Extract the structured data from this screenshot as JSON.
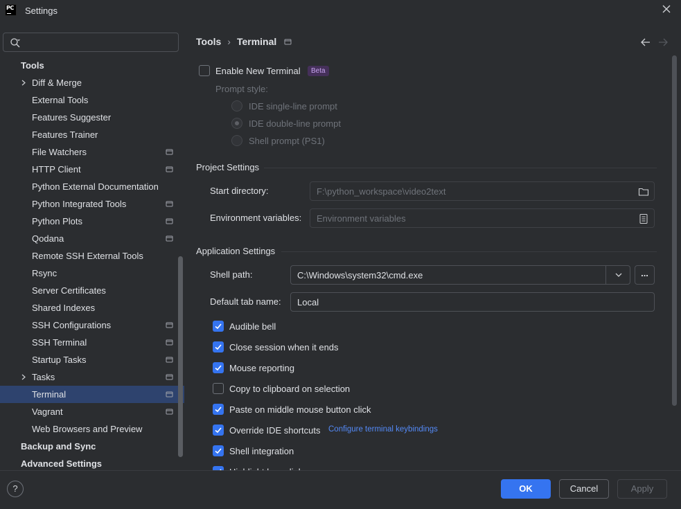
{
  "window": {
    "title": "Settings",
    "logo_text": "PC"
  },
  "search": {
    "placeholder": "",
    "value": ""
  },
  "sidebar": {
    "items": [
      {
        "label": "Tools",
        "level": 1,
        "chevron": false,
        "project": false,
        "selected": false
      },
      {
        "label": "Diff & Merge",
        "level": 2,
        "chevron": true,
        "project": false,
        "selected": false
      },
      {
        "label": "External Tools",
        "level": 2,
        "chevron": false,
        "project": false,
        "selected": false
      },
      {
        "label": "Features Suggester",
        "level": 2,
        "chevron": false,
        "project": false,
        "selected": false
      },
      {
        "label": "Features Trainer",
        "level": 2,
        "chevron": false,
        "project": false,
        "selected": false
      },
      {
        "label": "File Watchers",
        "level": 2,
        "chevron": false,
        "project": true,
        "selected": false
      },
      {
        "label": "HTTP Client",
        "level": 2,
        "chevron": false,
        "project": true,
        "selected": false
      },
      {
        "label": "Python External Documentation",
        "level": 2,
        "chevron": false,
        "project": false,
        "selected": false
      },
      {
        "label": "Python Integrated Tools",
        "level": 2,
        "chevron": false,
        "project": true,
        "selected": false
      },
      {
        "label": "Python Plots",
        "level": 2,
        "chevron": false,
        "project": true,
        "selected": false
      },
      {
        "label": "Qodana",
        "level": 2,
        "chevron": false,
        "project": true,
        "selected": false
      },
      {
        "label": "Remote SSH External Tools",
        "level": 2,
        "chevron": false,
        "project": false,
        "selected": false
      },
      {
        "label": "Rsync",
        "level": 2,
        "chevron": false,
        "project": false,
        "selected": false
      },
      {
        "label": "Server Certificates",
        "level": 2,
        "chevron": false,
        "project": false,
        "selected": false
      },
      {
        "label": "Shared Indexes",
        "level": 2,
        "chevron": false,
        "project": false,
        "selected": false
      },
      {
        "label": "SSH Configurations",
        "level": 2,
        "chevron": false,
        "project": true,
        "selected": false
      },
      {
        "label": "SSH Terminal",
        "level": 2,
        "chevron": false,
        "project": true,
        "selected": false
      },
      {
        "label": "Startup Tasks",
        "level": 2,
        "chevron": false,
        "project": true,
        "selected": false
      },
      {
        "label": "Tasks",
        "level": 2,
        "chevron": true,
        "project": true,
        "selected": false
      },
      {
        "label": "Terminal",
        "level": 2,
        "chevron": false,
        "project": true,
        "selected": true
      },
      {
        "label": "Vagrant",
        "level": 2,
        "chevron": false,
        "project": true,
        "selected": false
      },
      {
        "label": "Web Browsers and Preview",
        "level": 2,
        "chevron": false,
        "project": false,
        "selected": false
      },
      {
        "label": "Backup and Sync",
        "level": 1,
        "chevron": false,
        "project": false,
        "selected": false
      },
      {
        "label": "Advanced Settings",
        "level": 1,
        "chevron": false,
        "project": false,
        "selected": false
      }
    ]
  },
  "breadcrumb": {
    "parent": "Tools",
    "separator": "›",
    "current": "Terminal"
  },
  "new_terminal": {
    "label": "Enable New Terminal",
    "checked": false,
    "badge": "Beta",
    "prompt_style_label": "Prompt style:",
    "options": [
      "IDE single-line prompt",
      "IDE double-line prompt",
      "Shell prompt (PS1)"
    ],
    "selected_option": "IDE double-line prompt"
  },
  "project_settings": {
    "title": "Project Settings",
    "start_directory_label": "Start directory:",
    "start_directory_value": "F:\\python_workspace\\video2text",
    "env_vars_label": "Environment variables:",
    "env_vars_placeholder": "Environment variables"
  },
  "application_settings": {
    "title": "Application Settings",
    "shell_path_label": "Shell path:",
    "shell_path_value": "C:\\Windows\\system32\\cmd.exe",
    "browse_label": "...",
    "default_tab_label": "Default tab name:",
    "default_tab_value": "Local",
    "options": [
      {
        "label": "Audible bell",
        "checked": true
      },
      {
        "label": "Close session when it ends",
        "checked": true
      },
      {
        "label": "Mouse reporting",
        "checked": true
      },
      {
        "label": "Copy to clipboard on selection",
        "checked": false
      },
      {
        "label": "Paste on middle mouse button click",
        "checked": true
      },
      {
        "label": "Override IDE shortcuts",
        "checked": true
      },
      {
        "label": "Shell integration",
        "checked": true
      },
      {
        "label": "Highlight hyperlinks",
        "checked": true
      }
    ],
    "keybindings_link": "Configure terminal keybindings"
  },
  "footer": {
    "help": "?",
    "ok": "OK",
    "cancel": "Cancel",
    "apply": "Apply"
  },
  "colors": {
    "accent": "#3574f0",
    "selection": "#2e436e",
    "background": "#2b2d30",
    "link": "#548af7",
    "beta_badge": "#45305a"
  },
  "icons": {
    "search": "search-icon",
    "close": "close-icon",
    "back": "arrow-left-icon",
    "forward": "arrow-right-icon",
    "folder": "folder-icon",
    "env_editor": "list-icon",
    "project_scope": "project-scope-icon",
    "chevron": "chevron-right-icon",
    "dropdown": "chevron-down-icon"
  }
}
